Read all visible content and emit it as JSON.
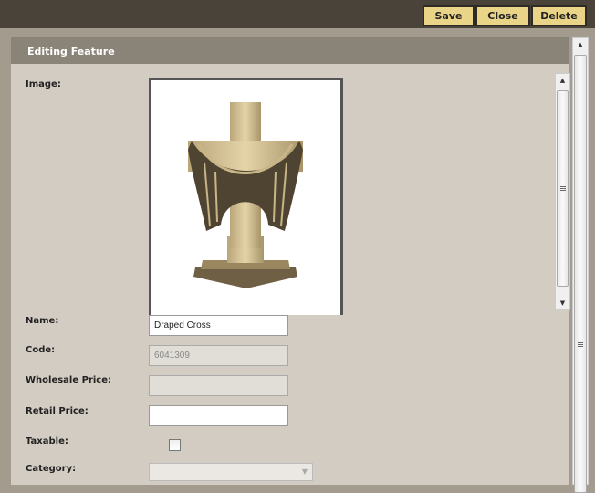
{
  "toolbar": {
    "save_label": "Save",
    "close_label": "Close",
    "delete_label": "Delete"
  },
  "panel": {
    "title": "Editing Feature"
  },
  "form": {
    "image_label": "Image:",
    "name_label": "Name:",
    "name_value": "Draped Cross",
    "code_label": "Code:",
    "code_value": "6041309",
    "wholesale_label": "Wholesale Price:",
    "wholesale_value": "",
    "retail_label": "Retail Price:",
    "retail_value": "",
    "taxable_label": "Taxable:",
    "taxable_checked": false,
    "category_label": "Category:",
    "category_value": ""
  },
  "colors": {
    "topbar": "#4a4339",
    "button": "#e9d488",
    "panel_header": "#8a8378",
    "panel_body": "#d3ccc2"
  }
}
